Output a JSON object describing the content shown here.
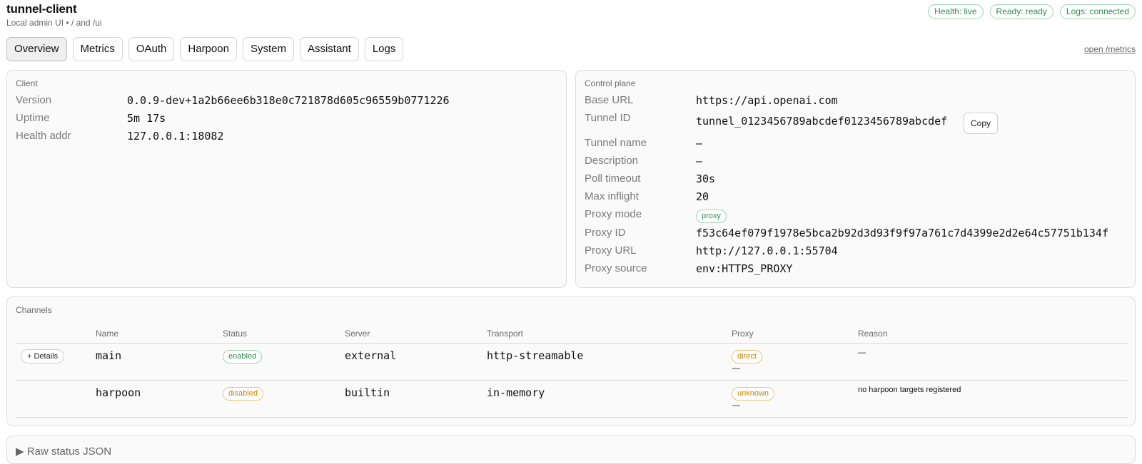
{
  "header": {
    "title": "tunnel-client",
    "subtitle": "Local admin UI • / and /ui",
    "pills": [
      "Health: live",
      "Ready: ready",
      "Logs: connected"
    ]
  },
  "tabs": [
    "Overview",
    "Metrics",
    "OAuth",
    "Harpoon",
    "System",
    "Assistant",
    "Logs"
  ],
  "active_tab": "Overview",
  "metrics_link": "open /metrics",
  "client": {
    "title": "Client",
    "rows": [
      {
        "label": "Version",
        "value": "0.0.9-dev+1a2b66ee6b318e0c721878d605c96559b0771226"
      },
      {
        "label": "Uptime",
        "value": "5m 17s"
      },
      {
        "label": "Health addr",
        "value": "127.0.0.1:18082"
      }
    ]
  },
  "control_plane": {
    "title": "Control plane",
    "copy_label": "Copy",
    "rows": [
      {
        "label": "Base URL",
        "value": "https://api.openai.com"
      },
      {
        "label": "Tunnel ID",
        "value": "tunnel_0123456789abcdef0123456789abcdef"
      },
      {
        "label": "Tunnel name",
        "value": "—"
      },
      {
        "label": "Description",
        "value": "—"
      },
      {
        "label": "Poll timeout",
        "value": "30s"
      },
      {
        "label": "Max inflight",
        "value": "20"
      },
      {
        "label": "Proxy mode",
        "value": "proxy"
      },
      {
        "label": "Proxy ID",
        "value": "f53c64ef079f1978e5bca2b92d3d93f9f97a761c7d4399e2d2e64c57751b134f"
      },
      {
        "label": "Proxy URL",
        "value": "http://127.0.0.1:55704"
      },
      {
        "label": "Proxy source",
        "value": "env:HTTPS_PROXY"
      }
    ]
  },
  "channels": {
    "title": "Channels",
    "columns": [
      "Name",
      "Status",
      "Server",
      "Transport",
      "Proxy",
      "Reason"
    ],
    "details_label": "+ Details",
    "rows": [
      {
        "name": "main",
        "status": "enabled",
        "server": "external",
        "transport": "http-streamable",
        "proxy": "direct",
        "proxy_sub": "—",
        "reason": "—"
      },
      {
        "name": "harpoon",
        "status": "disabled",
        "server": "builtin",
        "transport": "in-memory",
        "proxy": "unknown",
        "proxy_sub": "—",
        "reason": "no harpoon targets registered"
      }
    ]
  },
  "raw_json": {
    "arrow": "▶",
    "label": "Raw status JSON"
  },
  "colors": {
    "ok_green": "#2f8a55",
    "warn_orange": "#c88400"
  }
}
